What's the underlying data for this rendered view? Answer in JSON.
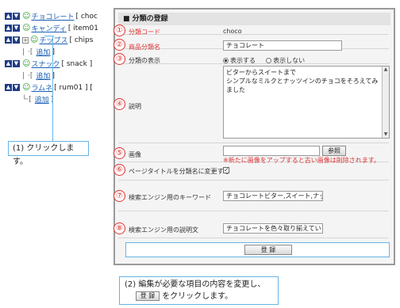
{
  "tree": {
    "items": [
      {
        "name": "チョコレート",
        "code": "[ choc"
      },
      {
        "name": "キャンディ",
        "code": "[ item01"
      },
      {
        "name": "チップス",
        "code": "[ chips"
      },
      {
        "sub_add": "追加"
      },
      {
        "name": "スナック",
        "code": "[ snack ]"
      },
      {
        "name": "ラムネ",
        "code": "[ rum01 ] ["
      },
      {
        "sub_add": "追加"
      },
      {
        "sub_add": "追加"
      }
    ]
  },
  "callout1": "(1) クリックします。",
  "form": {
    "header": "■ 分類の登録",
    "rows": [
      {
        "num": "①",
        "label": "分類コード",
        "value": "choco"
      },
      {
        "num": "②",
        "label": "商品分類名",
        "value": "チョコレート"
      },
      {
        "num": "③",
        "label": "分類の表示",
        "opt_show": "表示する",
        "opt_hide": "表示しない"
      },
      {
        "num": "④",
        "label": "説明",
        "lines": [
          "ビターからスイートまで",
          "シンプルなミルクとナッツインのチョコをそろえてみ",
          "ました"
        ]
      },
      {
        "num": "⑤",
        "label": "画像",
        "browse": "参照",
        "note": "※新たに画像をアップすると古い画像は削除されます。"
      },
      {
        "num": "⑥",
        "label": "ページタイトルを分類名に変更する",
        "checked": "✓"
      },
      {
        "num": "⑦",
        "label": "検索エンジン用のキーワード",
        "value": "チョコレートビター,スイート,ナッツ"
      },
      {
        "num": "⑧",
        "label": "検索エンジン用の説明文",
        "value": "チョコレートを色々取り揃えています"
      }
    ],
    "submit": "登 録"
  },
  "callout2": {
    "line1": "(2) 編集が必要な項目の内容を変更し、",
    "button": "登 録",
    "line2": "をクリックします。"
  }
}
